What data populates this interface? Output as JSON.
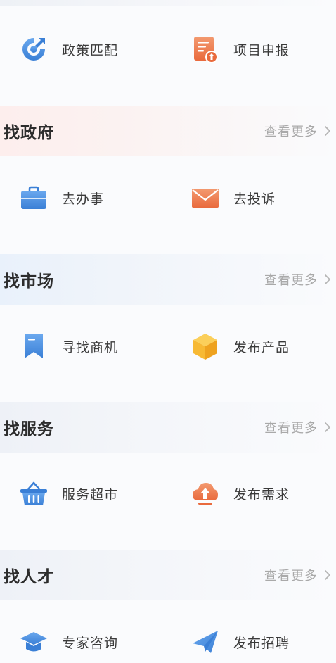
{
  "policy_row": {
    "left": {
      "label": "政策匹配",
      "icon": "refresh-target-icon"
    },
    "right": {
      "label": "项目申报",
      "icon": "document-upload-icon"
    }
  },
  "sections": {
    "gov": {
      "title": "找政府",
      "more_label": "查看更多",
      "items": [
        {
          "label": "去办事",
          "icon": "briefcase-icon"
        },
        {
          "label": "去投诉",
          "icon": "envelope-icon"
        }
      ]
    },
    "market": {
      "title": "找市场",
      "more_label": "查看更多",
      "items": [
        {
          "label": "寻找商机",
          "icon": "bookmark-icon"
        },
        {
          "label": "发布产品",
          "icon": "box-icon"
        }
      ]
    },
    "service": {
      "title": "找服务",
      "more_label": "查看更多",
      "items": [
        {
          "label": "服务超市",
          "icon": "basket-icon"
        },
        {
          "label": "发布需求",
          "icon": "cloud-upload-icon"
        }
      ]
    },
    "talent": {
      "title": "找人才",
      "more_label": "查看更多",
      "items": [
        {
          "label": "专家咨询",
          "icon": "graduation-cap-icon"
        },
        {
          "label": "发布招聘",
          "icon": "paper-plane-icon"
        }
      ]
    }
  },
  "colors": {
    "blue": "#4a8fe0",
    "orange": "#ef7b4f",
    "yellow": "#f7b934",
    "muted": "#a9a9a9"
  }
}
